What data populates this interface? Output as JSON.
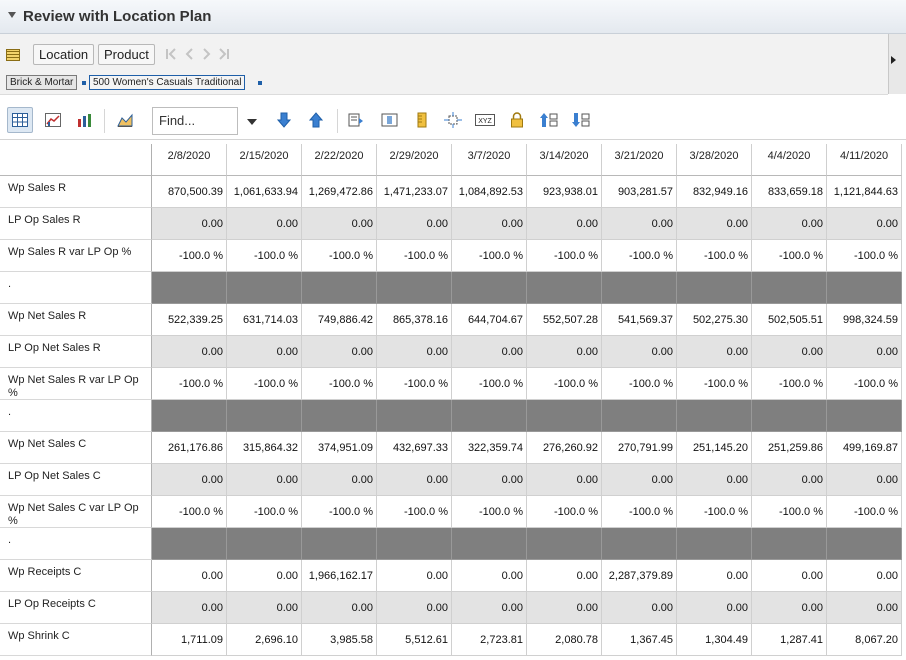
{
  "title": "Review with Location Plan",
  "context": {
    "location_label": "Location",
    "product_label": "Product",
    "nav": [
      "|<",
      "<",
      ">",
      ">|"
    ],
    "breadcrumbs": [
      "Brick & Mortar",
      "500 Women's Casuals Traditional"
    ]
  },
  "toolbar": {
    "find_placeholder": "Find...",
    "icons": [
      "table-view-icon",
      "chart-table-view-icon",
      "chart-view-icon",
      "area-chart-icon",
      "find-dropdown-icon",
      "find-next-icon",
      "find-previous-icon",
      "export-icon",
      "column-selection-icon",
      "ruler-icon",
      "pivot-icon",
      "xyz-format-icon",
      "lock-icon",
      "sort-ascending-icon",
      "sort-descending-icon"
    ]
  },
  "grid": {
    "columns": [
      "2/8/2020",
      "2/15/2020",
      "2/22/2020",
      "2/29/2020",
      "3/7/2020",
      "3/14/2020",
      "3/21/2020",
      "3/28/2020",
      "4/4/2020",
      "4/11/2020"
    ],
    "rows": [
      {
        "label": "Wp Sales R",
        "type": "white",
        "values": [
          "870,500.39",
          "1,061,633.94",
          "1,269,472.86",
          "1,471,233.07",
          "1,084,892.53",
          "923,938.01",
          "903,281.57",
          "832,949.16",
          "833,659.18",
          "1,121,844.63"
        ]
      },
      {
        "label": "LP Op Sales R",
        "type": "grey",
        "values": [
          "0.00",
          "0.00",
          "0.00",
          "0.00",
          "0.00",
          "0.00",
          "0.00",
          "0.00",
          "0.00",
          "0.00"
        ]
      },
      {
        "label": "Wp Sales R var LP Op %",
        "type": "white",
        "values": [
          "-100.0 %",
          "-100.0 %",
          "-100.0 %",
          "-100.0 %",
          "-100.0 %",
          "-100.0 %",
          "-100.0 %",
          "-100.0 %",
          "-100.0 %",
          "-100.0 %"
        ]
      },
      {
        "label": ".",
        "type": "dark",
        "values": [
          "",
          "",
          "",
          "",
          "",
          "",
          "",
          "",
          "",
          ""
        ]
      },
      {
        "label": "Wp Net Sales R",
        "type": "white",
        "values": [
          "522,339.25",
          "631,714.03",
          "749,886.42",
          "865,378.16",
          "644,704.67",
          "552,507.28",
          "541,569.37",
          "502,275.30",
          "502,505.51",
          "998,324.59"
        ]
      },
      {
        "label": "LP Op Net Sales R",
        "type": "grey",
        "values": [
          "0.00",
          "0.00",
          "0.00",
          "0.00",
          "0.00",
          "0.00",
          "0.00",
          "0.00",
          "0.00",
          "0.00"
        ]
      },
      {
        "label": "Wp Net Sales R var LP Op %",
        "type": "white",
        "values": [
          "-100.0 %",
          "-100.0 %",
          "-100.0 %",
          "-100.0 %",
          "-100.0 %",
          "-100.0 %",
          "-100.0 %",
          "-100.0 %",
          "-100.0 %",
          "-100.0 %"
        ]
      },
      {
        "label": ".",
        "type": "dark",
        "values": [
          "",
          "",
          "",
          "",
          "",
          "",
          "",
          "",
          "",
          ""
        ]
      },
      {
        "label": "Wp Net Sales C",
        "type": "white",
        "values": [
          "261,176.86",
          "315,864.32",
          "374,951.09",
          "432,697.33",
          "322,359.74",
          "276,260.92",
          "270,791.99",
          "251,145.20",
          "251,259.86",
          "499,169.87"
        ]
      },
      {
        "label": "LP Op Net Sales C",
        "type": "grey",
        "values": [
          "0.00",
          "0.00",
          "0.00",
          "0.00",
          "0.00",
          "0.00",
          "0.00",
          "0.00",
          "0.00",
          "0.00"
        ]
      },
      {
        "label": "Wp Net Sales C var LP Op %",
        "type": "white",
        "values": [
          "-100.0 %",
          "-100.0 %",
          "-100.0 %",
          "-100.0 %",
          "-100.0 %",
          "-100.0 %",
          "-100.0 %",
          "-100.0 %",
          "-100.0 %",
          "-100.0 %"
        ]
      },
      {
        "label": ".",
        "type": "dark",
        "values": [
          "",
          "",
          "",
          "",
          "",
          "",
          "",
          "",
          "",
          ""
        ]
      },
      {
        "label": "Wp Receipts C",
        "type": "white",
        "values": [
          "0.00",
          "0.00",
          "1,966,162.17",
          "0.00",
          "0.00",
          "0.00",
          "2,287,379.89",
          "0.00",
          "0.00",
          "0.00"
        ]
      },
      {
        "label": "LP Op Receipts C",
        "type": "grey",
        "values": [
          "0.00",
          "0.00",
          "0.00",
          "0.00",
          "0.00",
          "0.00",
          "0.00",
          "0.00",
          "0.00",
          "0.00"
        ]
      },
      {
        "label": "Wp Shrink C",
        "type": "white",
        "values": [
          "1,711.09",
          "2,696.10",
          "3,985.58",
          "5,512.61",
          "2,723.81",
          "2,080.78",
          "1,367.45",
          "1,304.49",
          "1,287.41",
          "8,067.20"
        ]
      }
    ]
  }
}
